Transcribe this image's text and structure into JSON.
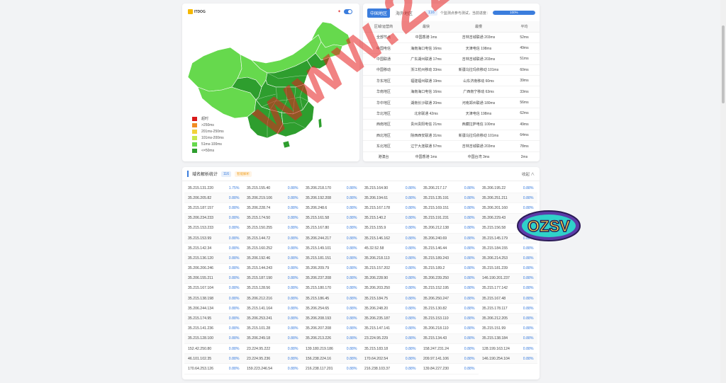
{
  "map_card": {
    "logo_text": "ITDOG",
    "star": "✦",
    "legend": [
      {
        "label": "超时",
        "color": "#d91a1a"
      },
      {
        "label": ">250ms",
        "color": "#f08c23"
      },
      {
        "label": "201ms-250ms",
        "color": "#f2d23a"
      },
      {
        "label": "101ms-200ms",
        "color": "#c6e84e"
      },
      {
        "label": "51ms-100ms",
        "color": "#66d94d"
      },
      {
        "label": "<=50ms",
        "color": "#2e9e2e"
      }
    ]
  },
  "latency": {
    "tabs": [
      {
        "label": "中国地区",
        "active": true
      },
      {
        "label": "海外地区",
        "active": false
      }
    ],
    "count": "116",
    "progress_text": "个监测点参与测试，当前进度：",
    "progress_value": "100%",
    "progress_fraction": 1.0,
    "headers": [
      "区域/运营商",
      "最快",
      "最慢",
      "平均"
    ],
    "rows": [
      [
        "全部节点",
        "中国香港 1ms",
        "吉林吉城联通 203ms",
        "52ms"
      ],
      [
        "中国电信",
        "海南海口电信 16ms",
        "天津电信 198ms",
        "49ms"
      ],
      [
        "中国联通",
        "广东湖州联通 17ms",
        "吉林吉城联通 203ms",
        "51ms"
      ],
      [
        "中国移动",
        "浙江杭州移动 33ms",
        "新疆乌拉玛依移动 101ms",
        "60ms"
      ],
      [
        "华东地区",
        "福建福州联通 19ms",
        "山东济南移动 60ms",
        "39ms"
      ],
      [
        "华南地区",
        "海南海口电信 16ms",
        "广西南宁移动 63ms",
        "33ms"
      ],
      [
        "华中地区",
        "湖南长沙联通 20ms",
        "河南郑州联通 180ms",
        "56ms"
      ],
      [
        "华北地区",
        "北京联通 42ms",
        "天津电信 198ms",
        "62ms"
      ],
      [
        "西南地区",
        "贵州贵阳电信 21ms",
        "西藏拉萨电信 100ms",
        "49ms"
      ],
      [
        "西北地区",
        "陕西西安联通 31ms",
        "新疆乌拉玛依移动 101ms",
        "64ms"
      ],
      [
        "东北地区",
        "辽宁大连联通 57ms",
        "吉林吉城联通 203ms",
        "78ms"
      ],
      [
        "港澳台",
        "中国香港 1ms",
        "中国台湾 3ms",
        "2ms"
      ]
    ]
  },
  "dns": {
    "title": "域名解析统计",
    "count": "116",
    "warn": "智能解析",
    "collapse": "收起 ∧",
    "rows": [
      [
        [
          "35.215.131.220",
          "1.75%"
        ],
        [
          "35.215.155.40",
          "0.88%"
        ],
        [
          "35.206.218.170",
          "0.88%"
        ],
        [
          "35.215.164.90",
          "0.88%"
        ],
        [
          "35.206.217.17",
          "0.88%"
        ],
        [
          "35.206.195.22",
          "0.88%"
        ]
      ],
      [
        [
          "35.206.205.82",
          "0.88%"
        ],
        [
          "35.206.219.106",
          "0.88%"
        ],
        [
          "35.206.192.208",
          "0.88%"
        ],
        [
          "35.206.194.61",
          "0.88%"
        ],
        [
          "35.215.135.191",
          "0.88%"
        ],
        [
          "35.206.251.211",
          "0.88%"
        ]
      ],
      [
        [
          "35.215.187.157",
          "0.88%"
        ],
        [
          "35.206.228.74",
          "0.88%"
        ],
        [
          "35.206.248.6",
          "0.88%"
        ],
        [
          "35.215.167.178",
          "0.88%"
        ],
        [
          "35.215.169.151",
          "0.88%"
        ],
        [
          "35.206.201.160",
          "0.88%"
        ]
      ],
      [
        [
          "35.206.234.233",
          "0.88%"
        ],
        [
          "35.215.174.50",
          "0.88%"
        ],
        [
          "35.215.161.58",
          "0.88%"
        ],
        [
          "35.215.140.2",
          "0.88%"
        ],
        [
          "35.215.191.231",
          "0.88%"
        ],
        [
          "35.206.229.43",
          "0.88%"
        ]
      ],
      [
        [
          "35.215.153.233",
          "0.88%"
        ],
        [
          "35.215.150.255",
          "0.88%"
        ],
        [
          "35.215.167.80",
          "0.88%"
        ],
        [
          "35.215.155.9",
          "0.88%"
        ],
        [
          "35.206.212.138",
          "0.88%"
        ],
        [
          "35.215.156.58",
          "0.88%"
        ]
      ],
      [
        [
          "35.215.153.99",
          "0.88%"
        ],
        [
          "35.215.144.72",
          "0.88%"
        ],
        [
          "35.206.244.217",
          "0.88%"
        ],
        [
          "35.215.146.162",
          "0.88%"
        ],
        [
          "35.206.240.69",
          "0.88%"
        ],
        [
          "35.215.145.179",
          "0.88%"
        ]
      ],
      [
        [
          "35.215.142.34",
          "0.88%"
        ],
        [
          "35.215.160.252",
          "0.88%"
        ],
        [
          "35.215.149.101",
          "0.88%"
        ],
        [
          "45.32.52.58",
          "0.88%"
        ],
        [
          "35.215.146.44",
          "0.88%"
        ],
        [
          "35.215.184.155",
          "0.88%"
        ]
      ],
      [
        [
          "35.215.136.120",
          "0.88%"
        ],
        [
          "35.206.192.46",
          "0.88%"
        ],
        [
          "35.215.181.151",
          "0.88%"
        ],
        [
          "35.206.218.113",
          "0.88%"
        ],
        [
          "35.215.189.243",
          "0.88%"
        ],
        [
          "35.206.214.253",
          "0.88%"
        ]
      ],
      [
        [
          "35.206.206.246",
          "0.88%"
        ],
        [
          "35.215.144.243",
          "0.88%"
        ],
        [
          "35.206.209.79",
          "0.88%"
        ],
        [
          "35.215.157.202",
          "0.88%"
        ],
        [
          "35.215.189.2",
          "0.88%"
        ],
        [
          "35.215.181.239",
          "0.88%"
        ]
      ],
      [
        [
          "35.206.155.211",
          "0.88%"
        ],
        [
          "35.215.187.190",
          "0.88%"
        ],
        [
          "35.206.237.208",
          "0.88%"
        ],
        [
          "35.206.228.90",
          "0.88%"
        ],
        [
          "35.206.239.250",
          "0.88%"
        ],
        [
          "146.190.201.237",
          "0.88%"
        ]
      ],
      [
        [
          "35.215.167.104",
          "0.88%"
        ],
        [
          "35.215.128.56",
          "0.88%"
        ],
        [
          "35.215.180.170",
          "0.88%"
        ],
        [
          "35.206.203.250",
          "0.88%"
        ],
        [
          "35.215.152.195",
          "0.88%"
        ],
        [
          "35.215.177.142",
          "0.88%"
        ]
      ],
      [
        [
          "35.215.138.198",
          "0.88%"
        ],
        [
          "35.206.212.216",
          "0.88%"
        ],
        [
          "35.215.186.45",
          "0.88%"
        ],
        [
          "35.215.184.75",
          "0.88%"
        ],
        [
          "35.206.250.247",
          "0.88%"
        ],
        [
          "35.215.167.48",
          "0.88%"
        ]
      ],
      [
        [
          "35.206.244.134",
          "0.88%"
        ],
        [
          "35.215.141.164",
          "0.88%"
        ],
        [
          "35.206.254.65",
          "0.88%"
        ],
        [
          "35.206.248.20",
          "0.88%"
        ],
        [
          "35.215.130.82",
          "0.88%"
        ],
        [
          "35.215.178.117",
          "0.88%"
        ]
      ],
      [
        [
          "35.215.174.95",
          "0.88%"
        ],
        [
          "35.206.253.241",
          "0.88%"
        ],
        [
          "35.206.208.193",
          "0.88%"
        ],
        [
          "35.206.235.187",
          "0.88%"
        ],
        [
          "35.215.153.110",
          "0.88%"
        ],
        [
          "35.206.212.205",
          "0.88%"
        ]
      ],
      [
        [
          "35.215.141.236",
          "0.88%"
        ],
        [
          "35.215.101.28",
          "0.88%"
        ],
        [
          "35.206.207.208",
          "0.88%"
        ],
        [
          "35.215.147.141",
          "0.88%"
        ],
        [
          "35.206.218.110",
          "0.88%"
        ],
        [
          "35.215.151.99",
          "0.88%"
        ]
      ],
      [
        [
          "35.215.128.100",
          "0.88%"
        ],
        [
          "35.206.249.18",
          "0.88%"
        ],
        [
          "35.206.213.226",
          "0.88%"
        ],
        [
          "23.224.95.229",
          "0.88%"
        ],
        [
          "35.215.134.43",
          "0.88%"
        ],
        [
          "35.215.138.184",
          "0.88%"
        ]
      ],
      [
        [
          "152.42.250.80",
          "0.88%"
        ],
        [
          "23.224.95.222",
          "0.88%"
        ],
        [
          "139.180.219.186",
          "0.88%"
        ],
        [
          "35.215.183.18",
          "0.88%"
        ],
        [
          "158.247.231.24",
          "0.88%"
        ],
        [
          "128.199.163.124",
          "0.88%"
        ]
      ],
      [
        [
          "46.101.102.35",
          "0.88%"
        ],
        [
          "23.224.95.236",
          "0.88%"
        ],
        [
          "156.238.224.16",
          "0.88%"
        ],
        [
          "170.64.202.54",
          "0.88%"
        ],
        [
          "209.97.141.106",
          "0.88%"
        ],
        [
          "146.190.254.104",
          "0.88%"
        ]
      ],
      [
        [
          "170.64.253.126",
          "0.88%"
        ],
        [
          "159.223.246.54",
          "0.88%"
        ],
        [
          "216.238.117.201",
          "0.88%"
        ],
        [
          "216.238.103.37",
          "0.88%"
        ],
        [
          "139.84.227.230",
          "0.88%"
        ]
      ]
    ]
  },
  "overlay": {
    "watermark": "www.2zka.cn",
    "sticker": "OZSV"
  }
}
